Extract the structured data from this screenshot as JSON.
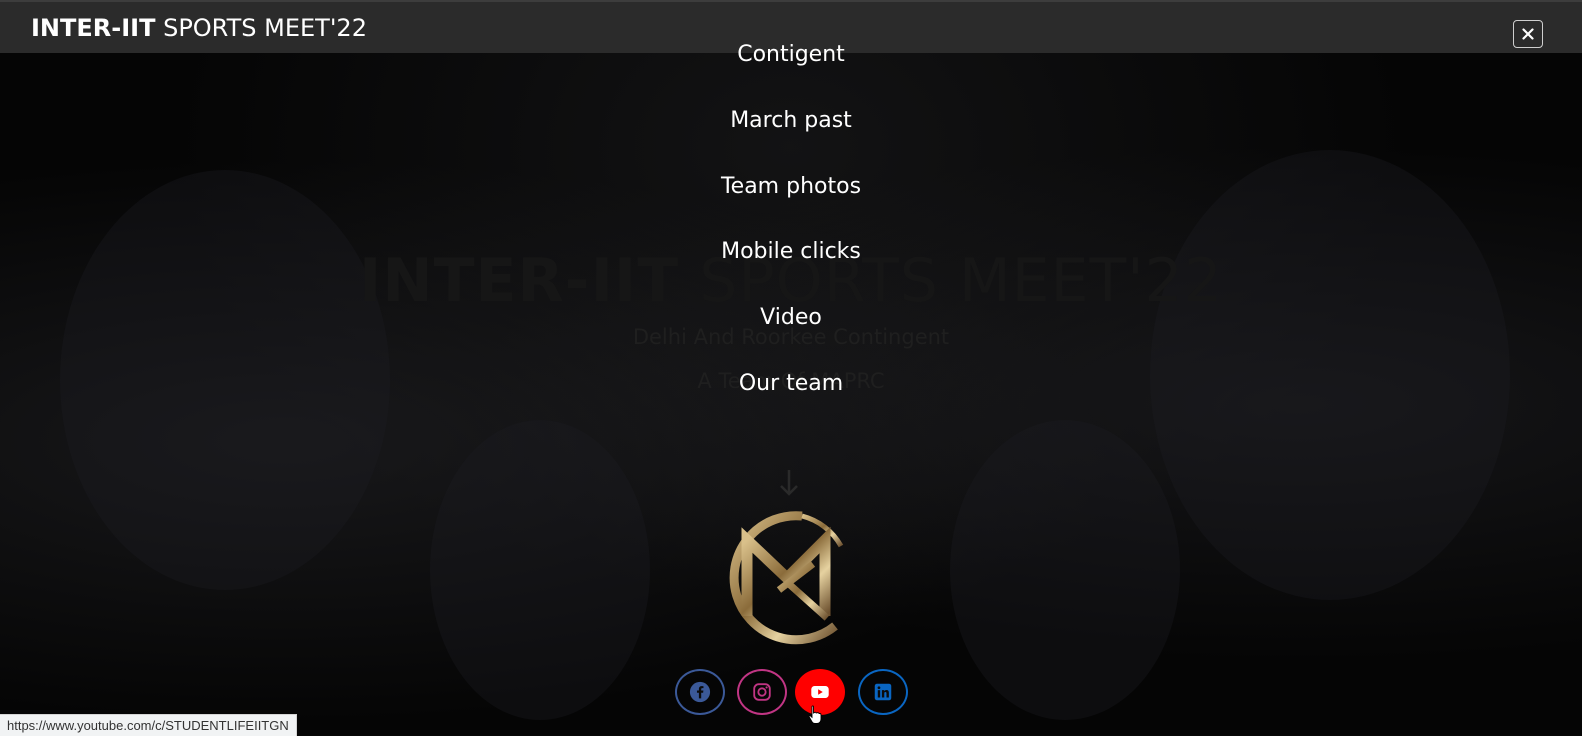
{
  "header": {
    "brand_bold": "INTER-IIT",
    "brand_rest": " SPORTS MEET'22",
    "close_icon": "close-icon"
  },
  "hero": {
    "title_bold": "INTER-IIT",
    "title_rest": " SPORTS MEET'22",
    "subtitle": "Delhi And Roorkee Contingent",
    "tagline": "A Team Of MAPRC",
    "arrow_icon": "arrow-down-icon"
  },
  "menu": {
    "items": [
      {
        "label": "Contigent"
      },
      {
        "label": "March past"
      },
      {
        "label": "Team photos"
      },
      {
        "label": "Mobile clicks"
      },
      {
        "label": "Video"
      },
      {
        "label": "Our team"
      }
    ]
  },
  "logo": {
    "icon": "mk-monogram-logo",
    "color": "#b89a62"
  },
  "social": [
    {
      "icon": "facebook-icon",
      "color": "#3b5998"
    },
    {
      "icon": "instagram-icon",
      "color": "#c13584"
    },
    {
      "icon": "youtube-icon",
      "color": "#ff0000"
    },
    {
      "icon": "linkedin-icon",
      "color": "#0a66c2"
    }
  ],
  "status_bar": {
    "url": "https://www.youtube.com/c/STUDENTLIFEIITGN"
  }
}
